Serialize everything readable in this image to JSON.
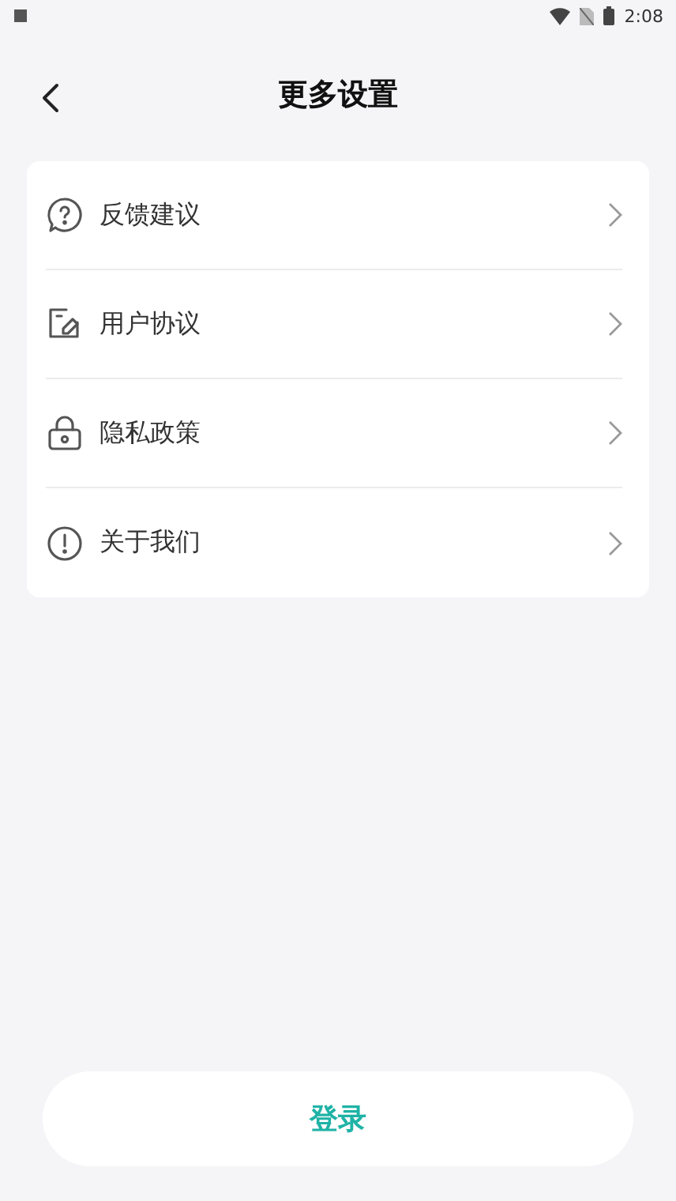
{
  "status_bar": {
    "time": "2:08"
  },
  "header": {
    "title": "更多设置"
  },
  "menu": [
    {
      "kind": "question",
      "label": "反馈建议"
    },
    {
      "kind": "edit",
      "label": "用户协议"
    },
    {
      "kind": "lock",
      "label": "隐私政策"
    },
    {
      "kind": "info",
      "label": "关于我们"
    }
  ],
  "login_button": "登录"
}
